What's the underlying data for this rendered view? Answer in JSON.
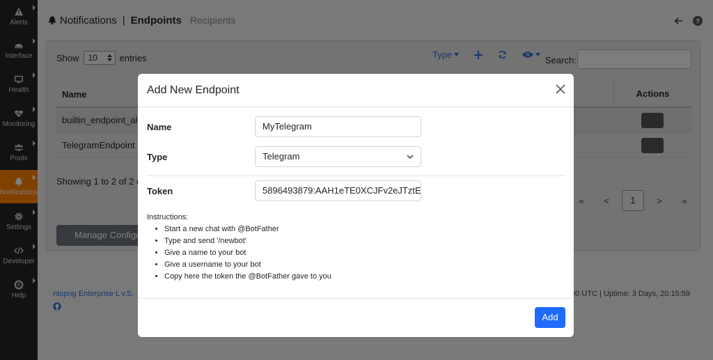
{
  "sidebar": {
    "items": [
      {
        "label": "Alerts",
        "icon": "alert-triangle-icon"
      },
      {
        "label": "Interface",
        "icon": "interface-icon"
      },
      {
        "label": "Health",
        "icon": "monitor-icon"
      },
      {
        "label": "Monitoring",
        "icon": "heartbeat-icon"
      },
      {
        "label": "Pools",
        "icon": "users-icon"
      },
      {
        "label": "Notifications",
        "icon": "bell-icon"
      },
      {
        "label": "Settings",
        "icon": "gear-icon"
      },
      {
        "label": "Developer",
        "icon": "code-icon"
      },
      {
        "label": "Help",
        "icon": "life-ring-icon"
      }
    ],
    "active_color": "#ff8000"
  },
  "header": {
    "title": "Notifications",
    "separator": "|",
    "active_tab": "Endpoints",
    "other_tab": "Recipients"
  },
  "table_controls": {
    "show_label": "Show",
    "page_size": "10",
    "entries_label": "entries",
    "type_filter": "Type",
    "search_label": "Search:"
  },
  "table": {
    "columns": [
      "Name",
      "Actions"
    ],
    "rows": [
      {
        "name": "builtin_endpoint_al"
      },
      {
        "name": "TelegramEndpoint"
      }
    ]
  },
  "pagination": {
    "showing_text": "Showing 1 to 2 of 2 e",
    "first": "«",
    "prev": "<",
    "current": "1",
    "next": ">",
    "last": "»"
  },
  "manage_button": "Manage Configu",
  "footer": {
    "version": "ntopng Enterprise L v.5.",
    "status": "00 UTC | Uptime: 3 Days, 20:15:59"
  },
  "modal": {
    "title": "Add New Endpoint",
    "name_label": "Name",
    "name_value": "MyTelegram",
    "type_label": "Type",
    "type_value": "Telegram",
    "token_label": "Token",
    "token_value": "5896493879:AAH1eTE0XCJFv2eJTztE",
    "instructions_title": "Instructions:",
    "instructions": [
      "Start a new chat with @BotFather",
      "Type and send '/newbot'",
      "Give a name to your bot",
      "Give a username to your bot",
      "Copy here the token the @BotFather gave to you"
    ],
    "add_label": "Add",
    "primary_color": "#1f6bff"
  }
}
